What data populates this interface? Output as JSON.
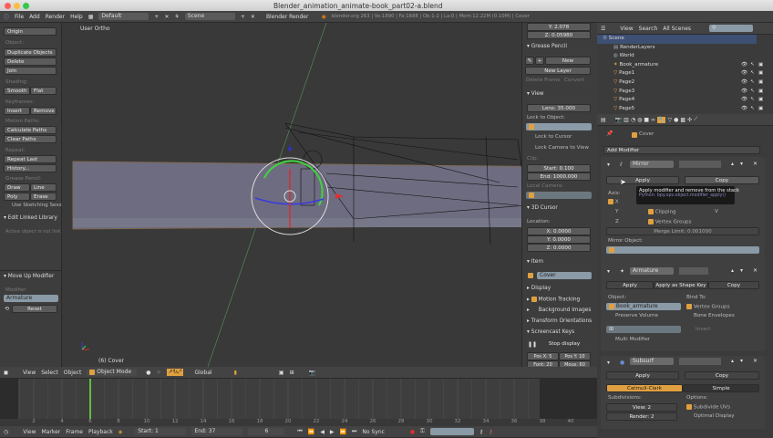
{
  "window": {
    "title": "Blender_animation_animate-book_part02-a.blend"
  },
  "info_header": {
    "menus": [
      "File",
      "Add",
      "Render",
      "Help"
    ],
    "layout": "Default",
    "scene": "Scene",
    "engine": "Blender Render",
    "stats": "blender.org 263 | Ve:1890 | Fa:1688 | Ob:1-2 | La:0 | Mem:12.22M (0.10M) | Cover"
  },
  "toolshelf": {
    "origin": "Origin",
    "object_label": "Object:",
    "duplicate": "Duplicate Objects",
    "delete": "Delete",
    "join": "Join",
    "shading_label": "Shading:",
    "smooth": "Smooth",
    "flat": "Flat",
    "keyframes_label": "Keyframes:",
    "insert": "Insert",
    "remove": "Remove",
    "motion_label": "Motion Paths:",
    "calc_paths": "Calculate Paths",
    "clear_paths": "Clear Paths",
    "repeat_label": "Repeat:",
    "repeat_last": "Repeat Last",
    "history": "History...",
    "gp_label": "Grease Pencil:",
    "draw": "Draw",
    "line": "Line",
    "poly": "Poly",
    "erase": "Erase",
    "sketching": "Use Sketching Sessi",
    "edit_linked": "Edit Linked Library",
    "active_note": "Active object is not link",
    "op_title": "Move Up Modifier",
    "modifier_label": "Modifier",
    "modifier_value": "Armature",
    "reset": "Reset"
  },
  "viewport": {
    "view_name": "User Ortho",
    "object_name": "(6) Cover"
  },
  "npanel": {
    "y": "Y: 2.078",
    "z": "Z: 0.05980",
    "grease_pencil": "Grease Pencil",
    "new": "New",
    "new_layer": "New Layer",
    "delete_frame": "Delete Frame",
    "convert": "Convert",
    "view": "View",
    "lens": "Lens: 35.000",
    "lock_object": "Lock to Object:",
    "lock_cursor": "Lock to Cursor",
    "lock_camera": "Lock Camera to View",
    "clip": "Clip:",
    "start": "Start: 0.100",
    "end": "End: 1000.000",
    "local_camera": "Local Camera:",
    "cursor3d": "3D Cursor",
    "location": "Location:",
    "cx": "X: 0.0000",
    "cy": "Y: 0.0000",
    "cz": "Z: 0.0000",
    "item": "Item",
    "item_name": "Cover",
    "display": "Display",
    "motion_tracking": "Motion Tracking",
    "bg_images": "Background Images",
    "transform_orient": "Transform Orientations",
    "screencast": "Screencast Keys",
    "stop_display": "Stop display",
    "posx": "Pos X: 5",
    "posy": "Pos Y: 10",
    "font": "Font: 20",
    "mous": "Mous: 60"
  },
  "outliner": {
    "view": "View",
    "search": "Search",
    "display": "All Scenes",
    "items": [
      {
        "name": "Scene"
      },
      {
        "name": "RenderLayers"
      },
      {
        "name": "World"
      },
      {
        "name": "Book_armature"
      },
      {
        "name": "Page1"
      },
      {
        "name": "Page2"
      },
      {
        "name": "Page3"
      },
      {
        "name": "Page4"
      },
      {
        "name": "Page5"
      }
    ]
  },
  "properties": {
    "context_object": "Cover",
    "add_modifier": "Add Modifier",
    "mirror": {
      "name": "Mirror",
      "apply": "Apply",
      "copy": "Copy",
      "axis": "Axis:",
      "x": "X",
      "y": "Y",
      "z": "Z",
      "clipping": "Clipping",
      "vertex_groups": "Vertex Groups",
      "v": "V",
      "merge": "Merge Limit: 0.001000",
      "mirror_object": "Mirror Object:"
    },
    "tooltip": {
      "title": "Apply modifier and remove from the stack",
      "python": "Python: bpy.ops.object.modifier_apply()"
    },
    "armature": {
      "name": "Armature",
      "apply": "Apply",
      "apply_shape": "Apply as Shape Key",
      "copy": "Copy",
      "object_label": "Object:",
      "object": "Book_armature",
      "bind_to": "Bind To:",
      "vertex_groups": "Vertex Groups",
      "preserve": "Preserve Volume",
      "bone_env": "Bone Envelopes",
      "invert": "Invert",
      "multi": "Multi Modifier"
    },
    "subsurf": {
      "name": "Subsurf",
      "apply": "Apply",
      "copy": "Copy",
      "catmull": "Catmull-Clark",
      "simple": "Simple",
      "subdivisions": "Subdivisions:",
      "view": "View: 2",
      "render": "Render: 2",
      "options": "Options:",
      "subdivide_uvs": "Subdivide UVs",
      "optimal": "Optimal Display"
    }
  },
  "view3d_header": {
    "menus": [
      "View",
      "Select",
      "Object"
    ],
    "mode": "Object Mode",
    "orientation": "Global"
  },
  "timeline": {
    "menus": [
      "View",
      "Marker",
      "Frame",
      "Playback"
    ],
    "start": "Start: 1",
    "end": "End: 37",
    "current": "6",
    "sync": "No Sync",
    "ticks": [
      "2",
      "4",
      "6",
      "8",
      "10",
      "12",
      "14",
      "16",
      "18",
      "20",
      "22",
      "24",
      "26",
      "28",
      "30",
      "32",
      "34",
      "36",
      "38",
      "40"
    ],
    "current_frame": 6
  },
  "colors": {
    "accent": "#e0a040",
    "selected": "#3d4f73",
    "bg": "#3a3a3a",
    "frame_line": "#5fbf3a"
  }
}
